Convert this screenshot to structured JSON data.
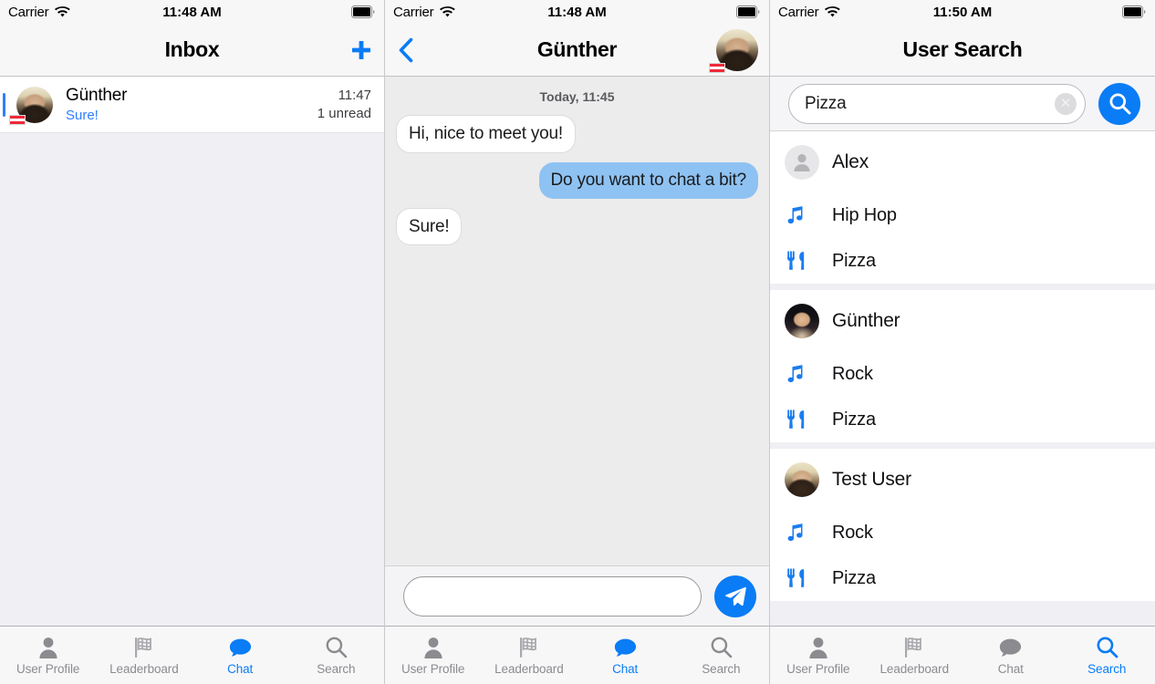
{
  "colors": {
    "accent": "#0a7cf5",
    "link": "#2f7dfd",
    "outgoing_bubble": "#8ec2f2",
    "incoming_bubble": "#ffffff",
    "tab_inactive": "#8b8b90",
    "nav_background": "#f7f7f8",
    "list_background": "#efeff4"
  },
  "screens": [
    {
      "name": "inbox",
      "status_bar": {
        "carrier": "Carrier",
        "wifi_icon": "wifi-icon",
        "time": "11:48 AM",
        "battery_icon": "battery-full-icon"
      },
      "nav": {
        "title": "Inbox",
        "right_button_icon": "plus-icon",
        "right_button_label": "+"
      },
      "conversations": [
        {
          "name": "Günther",
          "preview": "Sure!",
          "time": "11:47",
          "unread": "1 unread",
          "avatar_icon": "avatar",
          "flag_badge_icon": "austria-flag-icon",
          "unread_indicator": true
        }
      ],
      "tabbar": {
        "items": [
          {
            "label": "User Profile",
            "icon": "person-icon",
            "active": false
          },
          {
            "label": "Leaderboard",
            "icon": "checkered-flag-icon",
            "active": false
          },
          {
            "label": "Chat",
            "icon": "speech-bubble-icon",
            "active": true
          },
          {
            "label": "Search",
            "icon": "magnifier-icon",
            "active": false
          }
        ]
      }
    },
    {
      "name": "chat",
      "status_bar": {
        "carrier": "Carrier",
        "wifi_icon": "wifi-icon",
        "time": "11:48 AM",
        "battery_icon": "battery-full-icon"
      },
      "nav": {
        "title": "Günther",
        "back_button_icon": "chevron-left-icon",
        "avatar_icon": "avatar",
        "flag_badge_icon": "austria-flag-icon"
      },
      "conversation": {
        "daystamp": "Today, 11:45",
        "messages": [
          {
            "text": "Hi, nice to meet you!",
            "direction": "incoming"
          },
          {
            "text": "Do you want to chat a bit?",
            "direction": "outgoing"
          },
          {
            "text": "Sure!",
            "direction": "incoming"
          }
        ]
      },
      "composer": {
        "value": "",
        "placeholder": "",
        "send_button_icon": "send-paper-plane-icon"
      },
      "tabbar": {
        "items": [
          {
            "label": "User Profile",
            "icon": "person-icon",
            "active": false
          },
          {
            "label": "Leaderboard",
            "icon": "checkered-flag-icon",
            "active": false
          },
          {
            "label": "Chat",
            "icon": "speech-bubble-icon",
            "active": true
          },
          {
            "label": "Search",
            "icon": "magnifier-icon",
            "active": false
          }
        ]
      }
    },
    {
      "name": "user-search",
      "status_bar": {
        "carrier": "Carrier",
        "wifi_icon": "wifi-icon",
        "time": "11:50 AM",
        "battery_icon": "battery-full-icon"
      },
      "nav": {
        "title": "User Search"
      },
      "search": {
        "value": "Pizza",
        "placeholder": "",
        "clear_button_icon": "clear-circle-icon",
        "search_button_icon": "magnifier-icon"
      },
      "results": [
        {
          "user": "Alex",
          "avatar_icon": "person-placeholder-icon",
          "attributes": [
            {
              "label": "Hip Hop",
              "icon": "music-note-icon"
            },
            {
              "label": "Pizza",
              "icon": "fork-knife-icon"
            }
          ]
        },
        {
          "user": "Günther",
          "avatar_icon": "avatar",
          "attributes": [
            {
              "label": "Rock",
              "icon": "music-note-icon"
            },
            {
              "label": "Pizza",
              "icon": "fork-knife-icon"
            }
          ]
        },
        {
          "user": "Test User",
          "avatar_icon": "avatar",
          "attributes": [
            {
              "label": "Rock",
              "icon": "music-note-icon"
            },
            {
              "label": "Pizza",
              "icon": "fork-knife-icon"
            }
          ]
        }
      ],
      "tabbar": {
        "items": [
          {
            "label": "User Profile",
            "icon": "person-icon",
            "active": false
          },
          {
            "label": "Leaderboard",
            "icon": "checkered-flag-icon",
            "active": false
          },
          {
            "label": "Chat",
            "icon": "speech-bubble-icon",
            "active": false
          },
          {
            "label": "Search",
            "icon": "magnifier-icon",
            "active": true
          }
        ]
      }
    }
  ]
}
